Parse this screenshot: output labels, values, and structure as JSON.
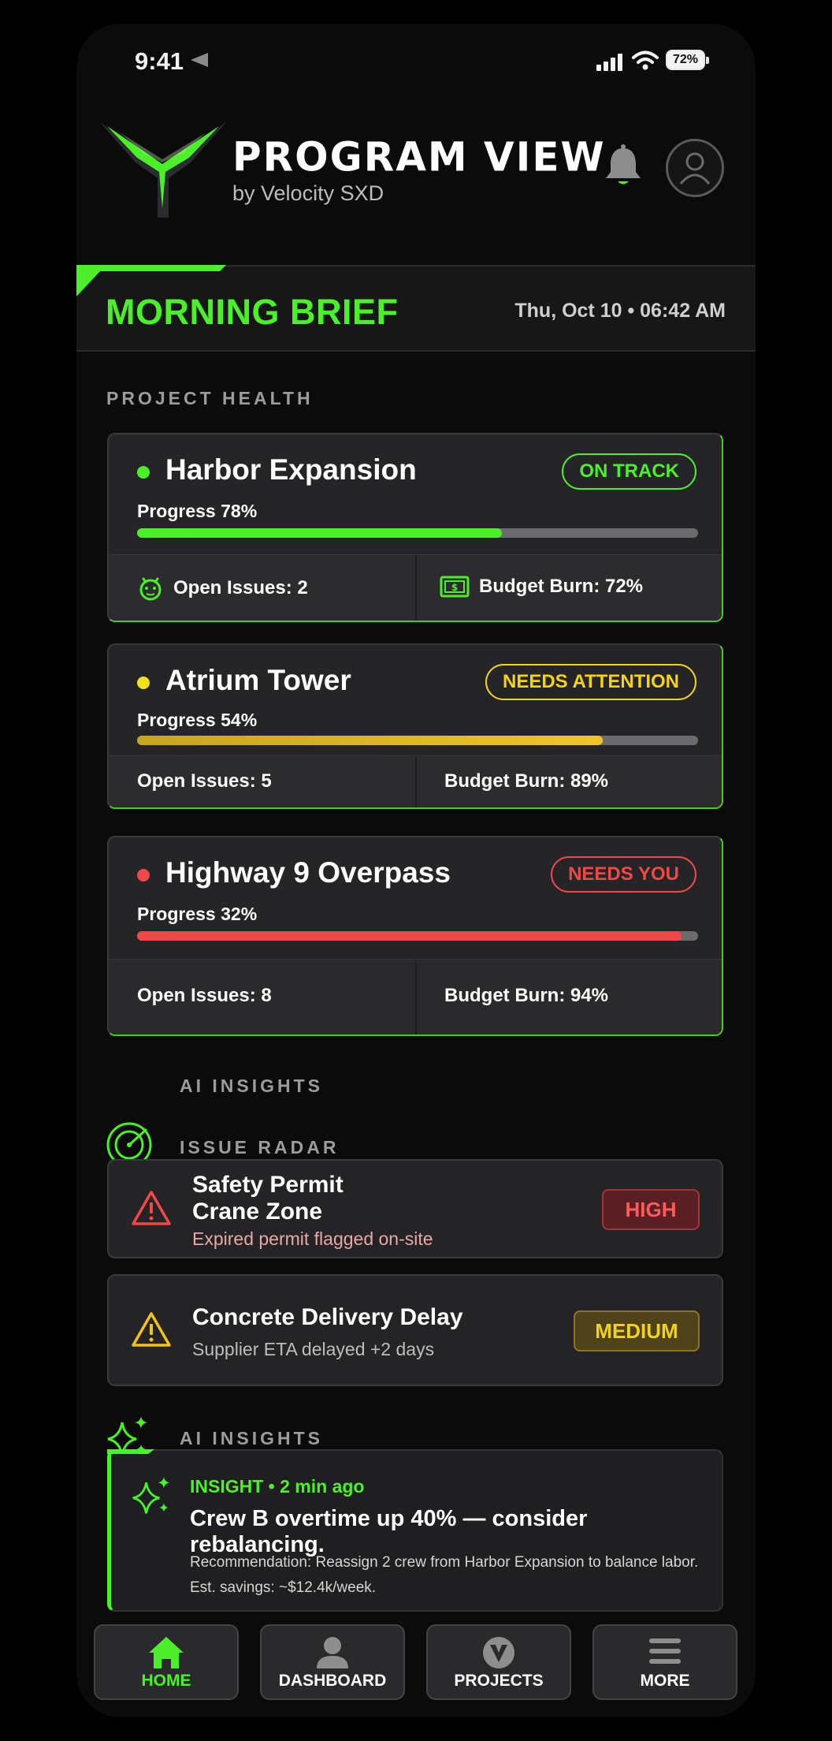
{
  "status_bar": {
    "time": "9:41",
    "battery": "72%"
  },
  "header": {
    "title": "PROGRAM VIEW",
    "subtitle": "by Velocity SXD"
  },
  "brief": {
    "title": "MORNING BRIEF",
    "date": "Thu, Oct 10 • 06:42 AM"
  },
  "sections": {
    "project_health": "PROJECT HEALTH",
    "ai_insights_top": "AI INSIGHTS",
    "issue_radar": "ISSUE RADAR",
    "ai_insights": "AI INSIGHTS"
  },
  "colors": {
    "green": "#4cf02a",
    "yellow": "#f2d21b",
    "red": "#f04848"
  },
  "projects": [
    {
      "name": "Harbor Expansion",
      "status": "ON TRACK",
      "progress_label": "Progress 78%",
      "progress": 0.78,
      "fill_fraction": 0.65,
      "issues": "Open Issues: 2",
      "budget": "Budget Burn: 72%"
    },
    {
      "name": "Atrium Tower",
      "status": "NEEDS ATTENTION",
      "progress_label": "Progress 54%",
      "progress": 0.54,
      "fill_fraction": 0.83,
      "issues": "Open Issues: 5",
      "budget": "Budget Burn: 89%"
    },
    {
      "name": "Highway 9 Overpass",
      "status": "NEEDS YOU",
      "progress_label": "Progress 32%",
      "progress": 0.32,
      "fill_fraction": 0.97,
      "issues": "Open Issues: 8",
      "budget": "Budget Burn: 94%"
    }
  ],
  "issues": [
    {
      "title_line1": "Safety Permit",
      "title_line2": "Crane Zone",
      "detail": "Expired permit flagged on-site",
      "severity": "HIGH",
      "icon": "warning-triangle-icon"
    },
    {
      "title_line1": "Concrete Delivery Delay",
      "detail": "Supplier ETA delayed +2 days",
      "severity": "MEDIUM",
      "icon": "warning-triangle-icon"
    }
  ],
  "insight": {
    "meta": "INSIGHT • 2 min ago",
    "headline": "Crew B overtime up 40% — consider rebalancing.",
    "line1": "Recommendation: Reassign 2 crew from Harbor Expansion to balance labor.",
    "line2": "Est. savings: ~$12.4k/week."
  },
  "nav": [
    {
      "label": "HOME",
      "icon": "home-icon",
      "active": true
    },
    {
      "label": "DASHBOARD",
      "icon": "user-icon",
      "active": false
    },
    {
      "label": "PROJECTS",
      "icon": "projects-icon",
      "active": false
    },
    {
      "label": "MORE",
      "icon": "menu-icon",
      "active": false
    }
  ]
}
